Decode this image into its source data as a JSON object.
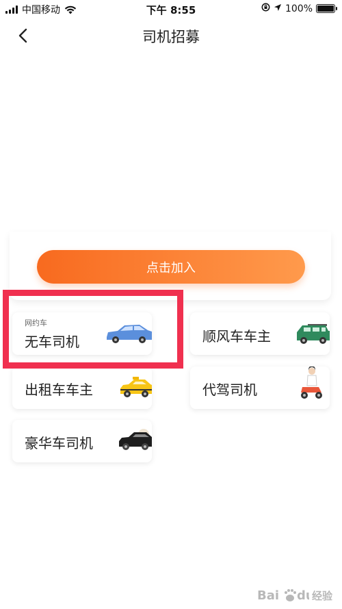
{
  "status_bar": {
    "carrier": "中国移动",
    "time": "下午 8:55",
    "battery_percent": "100%"
  },
  "nav": {
    "title": "司机招募"
  },
  "join_button": {
    "label": "点击加入"
  },
  "roles": [
    {
      "tag": "网约车",
      "label": "无车司机",
      "icon": "blue-sedan-icon"
    },
    {
      "label": "顺风车车主",
      "icon": "green-suv-icon"
    },
    {
      "label": "出租车车主",
      "icon": "yellow-taxi-icon"
    },
    {
      "label": "代驾司机",
      "icon": "scooter-rider-icon"
    },
    {
      "label": "豪华车司机",
      "icon": "black-limousine-icon"
    }
  ],
  "watermark": {
    "text": "经验"
  },
  "colors": {
    "accent_start": "#f86a1f",
    "accent_end": "#ff9a4c",
    "highlight": "#f0304f"
  }
}
